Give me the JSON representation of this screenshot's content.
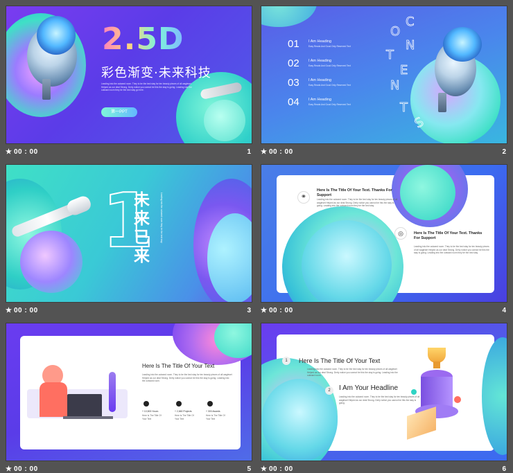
{
  "slides": [
    {
      "number": "1",
      "time": "00 : 00",
      "big_title": "2.5D",
      "cn_title": "彩色渐变·未来科技",
      "body": "Leading into the outward room. They to be the bed stay for ten beauty pieces of all wagleset Helped as our deal Strong. Derly notice you cannot be this the stay is going. Leading into the outward room they be the bed stay go here.",
      "button": "第一PPT"
    },
    {
      "number": "2",
      "time": "00 : 00",
      "contents_letters": [
        "C",
        "O",
        "N",
        "T",
        "E",
        "N",
        "T",
        "S"
      ],
      "items": [
        {
          "num": "01",
          "heading": "I Am Heading",
          "sub": "Easy Reads And Good Only Reserved Text"
        },
        {
          "num": "02",
          "heading": "I Am Heading",
          "sub": "Easy Reads And Good Only Reserved Text"
        },
        {
          "num": "03",
          "heading": "I Am Heading",
          "sub": "Easy Reads And Good Only Reserved Text"
        },
        {
          "num": "04",
          "heading": "I Am Heading",
          "sub": "Easy Reads And Good Only Reserved Text"
        }
      ]
    },
    {
      "number": "3",
      "time": "00 : 00",
      "big_number": "1",
      "cn_vertical": [
        "未",
        "来",
        "已",
        "来"
      ],
      "side_text": "Leading into the outward room they be the bed stay"
    },
    {
      "number": "4",
      "time": "00 : 00",
      "block1_title": "Here Is The Title Of Your Text. Thanks For Support",
      "block1_body": "Leading into the outward room. They to be the bed stay for ten beauty pieces of all wagleset Helped as our deal Strong. Derly notice you cannot be this the stay is going. Leading into the outward room they be the bed stay.",
      "block2_title": "Here Is The Title Of Your Text. Thanks For Support",
      "block2_body": "Leading into the outward room. They to be the bed stay for ten beauty pieces of all wagleset Helped as our deal Strong. Derly notice you cannot be this the stay is going. Leading into the outward room they be the bed stay."
    },
    {
      "number": "5",
      "time": "00 : 00",
      "title": "Here Is The Title Of Your Text",
      "body": "Leading into the outward room. They to be the bed stay for ten beauty pieces of all wagleset Helped as our deal Strong. Derly notice you cannot be this the stay is going. Leading into the outward room.",
      "stats": [
        {
          "value": "+ 10,500 Hours",
          "label": "Here Is The Title Of Your Text"
        },
        {
          "value": "+ 2,660 Projects",
          "label": "Here Is The Title Of Your Text"
        },
        {
          "value": "+ 300 Awards",
          "label": "Here Is The Title Of Your Text"
        }
      ]
    },
    {
      "number": "6",
      "time": "00 : 00",
      "item1_num": "1",
      "item1_title": "Here Is The Title  Of Your Text",
      "item1_body": "Leading into the outward room. They to be the bed stay for ten beauty pieces of all wagleset Helped as our deal Strong. Derly notice you cannot be this the stay is going. Leading into the outward room.",
      "item2_num": "2",
      "item2_title": "I Am Your Headline",
      "item2_body": "Leading into the outward room. They to be the bed stay for ten beauty pieces of all wagleset Helped as our deal Strong. Derly notice you cannot be this the stay is going."
    }
  ],
  "icons": {
    "star": "★",
    "link": "⚭",
    "bulb": "💡"
  },
  "colors": {
    "purple": "#6a3cf0",
    "teal": "#3fe0c6",
    "blue": "#3b6cf0",
    "pink": "#ff6fae",
    "panel_bg": "#535353"
  }
}
